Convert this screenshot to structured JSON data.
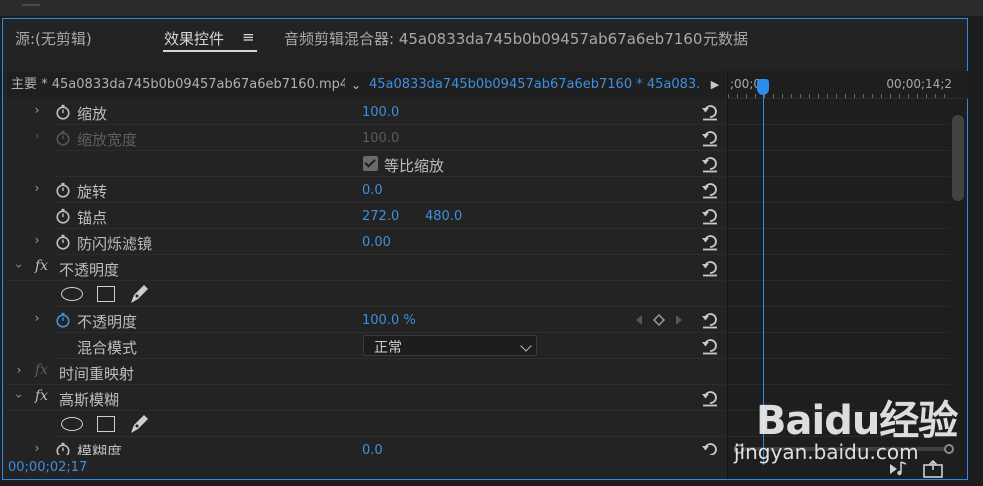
{
  "tabs": {
    "source": "源:(无剪辑)",
    "effect_controls": "效果控件",
    "menu_glyph": "≡",
    "audio_mixer": "音频剪辑混合器: 45a0833da745b0b09457ab67a6eb7160",
    "metadata": "元数据"
  },
  "clipbar": {
    "main_clip": "主要 * 45a0833da745b0b09457ab67a6eb7160.mp4",
    "sequence_clip": "45a0833da745b0b09457ab67a6eb7160 * 45a083..."
  },
  "timeline": {
    "start_time": ";00;00",
    "end_time": "00;00;14;2"
  },
  "properties": {
    "scale": {
      "label": "缩放",
      "value": "100.0"
    },
    "scale_width": {
      "label": "缩放宽度",
      "value": "100.0"
    },
    "uniform_scale": {
      "label": "等比缩放",
      "checked": true
    },
    "rotation": {
      "label": "旋转",
      "value": "0.0"
    },
    "anchor": {
      "label": "锚点",
      "x": "272.0",
      "y": "480.0"
    },
    "anti_flicker": {
      "label": "防闪烁滤镜",
      "value": "0.00"
    },
    "opacity_section": {
      "fx": "fx",
      "label": "不透明度"
    },
    "opacity": {
      "label": "不透明度",
      "value": "100.0 %"
    },
    "blend_mode": {
      "label": "混合模式",
      "value": "正常"
    },
    "time_remap": {
      "fx": "fx",
      "label": "时间重映射"
    },
    "gaussian_blur": {
      "fx": "fx",
      "label": "高斯模糊"
    },
    "blurriness": {
      "label": "模糊度",
      "value": "0.0"
    }
  },
  "footer": {
    "timecode": "00;00;02;17"
  },
  "watermark": {
    "logo": "Baidu经验",
    "url": "jingyan.baidu.com"
  },
  "colors": {
    "accent_blue": "#2d8ceb",
    "value_blue": "#3d8fe0",
    "panel_bg": "#232323"
  }
}
